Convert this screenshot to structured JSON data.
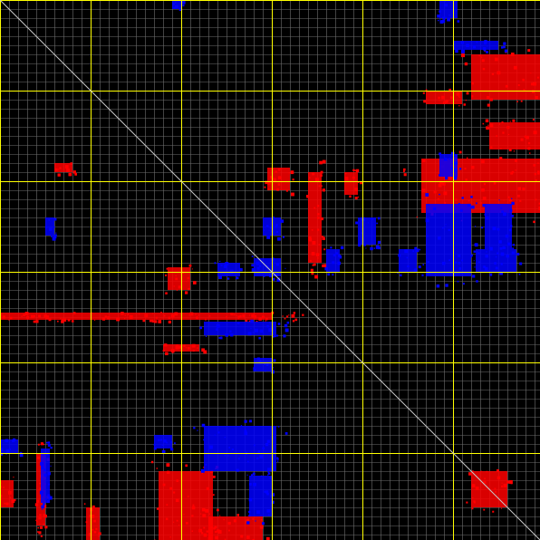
{
  "chart_data": {
    "type": "heatmap",
    "title": "",
    "xlabel": "",
    "ylabel": "",
    "matrix_size": 596,
    "minor_grid_step": 10,
    "major_grid_step": 100,
    "grid": true,
    "colors": {
      "background": "#000000",
      "minor_grid": "#6e6e6e",
      "major_grid": "#ffff00",
      "diagonal": "#c8c8c8",
      "positive": "#ff0000",
      "negative": "#0000ff"
    },
    "series": [
      {
        "sign": "positive",
        "color": "#ff0000",
        "regions": [
          [
            465,
            175,
            140,
            60
          ],
          [
            520,
            60,
            76,
            50
          ],
          [
            540,
            135,
            56,
            30
          ],
          [
            295,
            185,
            25,
            25
          ],
          [
            185,
            295,
            25,
            25
          ],
          [
            340,
            190,
            15,
            100
          ],
          [
            175,
            520,
            60,
            76
          ],
          [
            230,
            570,
            60,
            26
          ],
          [
            0,
            530,
            15,
            30
          ],
          [
            60,
            180,
            20,
            10
          ],
          [
            470,
            100,
            40,
            15
          ],
          [
            0,
            345,
            300,
            8
          ],
          [
            180,
            380,
            40,
            8
          ],
          [
            40,
            500,
            10,
            80
          ],
          [
            95,
            560,
            15,
            36
          ],
          [
            520,
            520,
            40,
            40
          ],
          [
            380,
            190,
            15,
            25
          ]
        ]
      },
      {
        "sign": "negative",
        "color": "#0000ff",
        "regions": [
          [
            470,
            225,
            50,
            80
          ],
          [
            525,
            275,
            45,
            25
          ],
          [
            535,
            225,
            30,
            50
          ],
          [
            225,
            470,
            80,
            50
          ],
          [
            275,
            525,
            25,
            45
          ],
          [
            280,
            285,
            30,
            20
          ],
          [
            240,
            290,
            25,
            15
          ],
          [
            0,
            485,
            20,
            15
          ],
          [
            360,
            275,
            15,
            25
          ],
          [
            440,
            275,
            20,
            25
          ],
          [
            485,
            170,
            20,
            25
          ],
          [
            485,
            0,
            20,
            20
          ],
          [
            190,
            0,
            10,
            10
          ],
          [
            225,
            355,
            80,
            15
          ],
          [
            280,
            395,
            20,
            15
          ],
          [
            170,
            480,
            20,
            15
          ],
          [
            50,
            240,
            10,
            20
          ],
          [
            290,
            240,
            20,
            20
          ],
          [
            45,
            495,
            10,
            60
          ],
          [
            395,
            240,
            20,
            30
          ],
          [
            500,
            45,
            50,
            10
          ]
        ]
      }
    ]
  }
}
